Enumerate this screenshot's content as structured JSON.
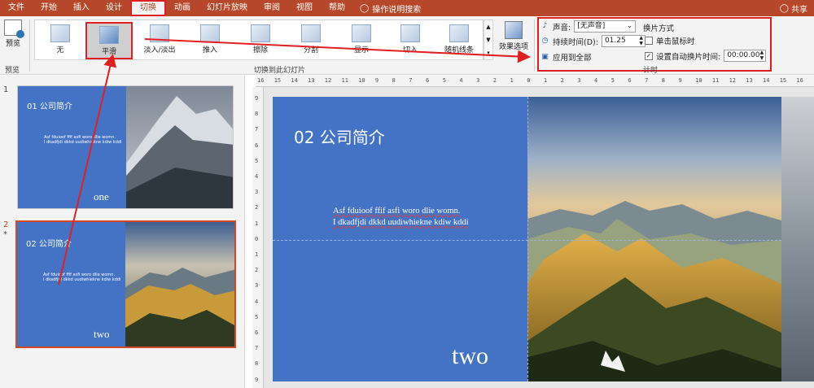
{
  "tabs": [
    {
      "label": "文件",
      "active": false
    },
    {
      "label": "开始",
      "active": false
    },
    {
      "label": "插入",
      "active": false
    },
    {
      "label": "设计",
      "active": false
    },
    {
      "label": "切换",
      "active": true
    },
    {
      "label": "动画",
      "active": false
    },
    {
      "label": "幻灯片放映",
      "active": false
    },
    {
      "label": "审阅",
      "active": false
    },
    {
      "label": "视图",
      "active": false
    },
    {
      "label": "帮助",
      "active": false
    }
  ],
  "tell_me": "操作说明搜索",
  "share": "共享",
  "ribbon": {
    "preview_label": "预览",
    "preview_group": "预览",
    "transitions": [
      "无",
      "平滑",
      "淡入/淡出",
      "推入",
      "擦除",
      "分割",
      "显示",
      "切入",
      "随机线条"
    ],
    "selected_transition": "平滑",
    "effect_options": "效果选项",
    "transitions_group": "切换到此幻灯片",
    "timing": {
      "sound_label": "声音:",
      "sound_value": "[无声音]",
      "duration_label": "持续时间(D):",
      "duration_value": "01.25",
      "apply_all": "应用到全部",
      "advance_title": "换片方式",
      "on_click": "单击鼠标时",
      "on_click_checked": false,
      "after_label": "设置自动换片时间:",
      "after_checked": true,
      "after_value": "00:00.00",
      "group_label": "计时"
    }
  },
  "slides": [
    {
      "number": "1",
      "title": "01 公司简介",
      "body_1": "Asf  fduioof  ffif asfi woro dlie womn.",
      "body_2": "I dkadfjdi dkkd uudiwhiekne kdiw kddi",
      "word": "one",
      "selected": false
    },
    {
      "number": "2",
      "star": "*",
      "title": "02 公司简介",
      "body_1": "Asf  fduioof  ffif asfi woro dlie womn.",
      "body_2": "I dkadfjdi dkkd uudiwhiekne kdiw kddi",
      "word": "two",
      "selected": true
    }
  ],
  "main_slide": {
    "title": "02 公司简介",
    "body_1": "Asf  fduioof  ffif asfi woro dlie womn.",
    "body_2": "I dkadfjdi dkkd uudiwhiekne kdiw kddi",
    "word": "two"
  },
  "ruler_h": [
    "16",
    "15",
    "14",
    "13",
    "12",
    "11",
    "10",
    "9",
    "8",
    "7",
    "6",
    "5",
    "4",
    "3",
    "2",
    "1",
    "0",
    "1",
    "2",
    "3",
    "4",
    "5",
    "6",
    "7",
    "8",
    "9",
    "10",
    "11",
    "12",
    "13",
    "14",
    "15",
    "16"
  ],
  "ruler_v": [
    "9",
    "8",
    "7",
    "6",
    "5",
    "4",
    "3",
    "2",
    "1",
    "0",
    "1",
    "2",
    "3",
    "4",
    "5",
    "6",
    "7",
    "8",
    "9"
  ],
  "colors": {
    "accent": "#b7472a",
    "slide_bg": "#4472c4",
    "highlight": "#e02020"
  }
}
